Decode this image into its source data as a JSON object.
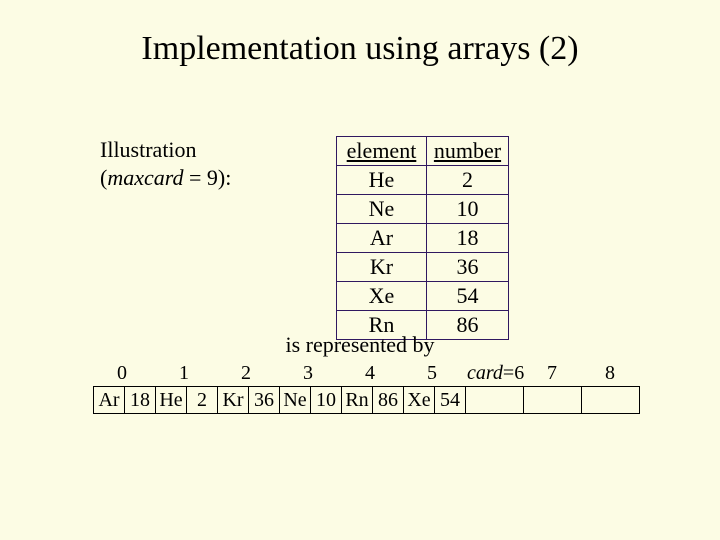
{
  "title": "Implementation using arrays (2)",
  "caption": {
    "line1": "Illustration",
    "maxcard_word": "maxcard",
    "maxcard_value": "9"
  },
  "table": {
    "headers": [
      "element",
      "number"
    ],
    "rows": [
      {
        "element": "He",
        "number": "2"
      },
      {
        "element": "Ne",
        "number": "10"
      },
      {
        "element": "Ar",
        "number": "18"
      },
      {
        "element": "Kr",
        "number": "36"
      },
      {
        "element": "Xe",
        "number": "54"
      },
      {
        "element": "Rn",
        "number": "86"
      }
    ]
  },
  "represented_by": "is represented by",
  "array": {
    "indices": [
      "0",
      "1",
      "2",
      "3",
      "4",
      "5",
      "",
      "7",
      "8"
    ],
    "card_label": "card",
    "card_value": "6",
    "cells": [
      {
        "el": "Ar",
        "num": "18"
      },
      {
        "el": "He",
        "num": "2"
      },
      {
        "el": "Kr",
        "num": "36"
      },
      {
        "el": "Ne",
        "num": "10"
      },
      {
        "el": "Rn",
        "num": "86"
      },
      {
        "el": "Xe",
        "num": "54"
      }
    ]
  }
}
